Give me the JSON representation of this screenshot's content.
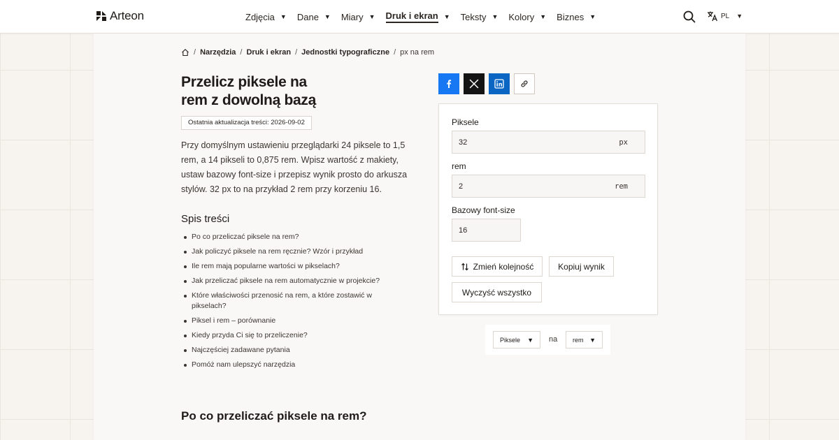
{
  "header": {
    "brand": "Arteon",
    "nav": [
      {
        "label": "Zdjęcia",
        "active": false
      },
      {
        "label": "Dane",
        "active": false
      },
      {
        "label": "Miary",
        "active": false
      },
      {
        "label": "Druk i ekran",
        "active": true
      },
      {
        "label": "Teksty",
        "active": false
      },
      {
        "label": "Kolory",
        "active": false
      },
      {
        "label": "Biznes",
        "active": false
      }
    ],
    "search_icon": "search-icon",
    "language": "PL",
    "language_icon": "translate-icon"
  },
  "breadcrumb": {
    "home_icon": "home-icon",
    "items": [
      "Narzędzia",
      "Druk i ekran",
      "Jednostki typograficzne"
    ],
    "current": "px na rem"
  },
  "article": {
    "title_line1": "Przelicz piksele na",
    "title_line2": "rem z dowolną bazą",
    "updated": "Ostatnia aktualizacja treści: 2026-09-02",
    "intro": "Przy domyślnym ustawieniu przeglądarki 24 piksele to 1,5 rem, a 14 pikseli to 0,875 rem. Wpisz wartość z makiety, ustaw bazowy font-size i przepisz wynik prosto do arkusza stylów. 32 px to na przykład 2 rem przy korzeniu 16.",
    "toc_title": "Spis treści",
    "toc": [
      "Po co przeliczać piksele na rem?",
      "Jak policzyć piksele na rem ręcznie? Wzór i przykład",
      "Ile rem mają popularne wartości w pikselach?",
      "Jak przeliczać piksele na rem automatycznie w projekcie?",
      "Które właściwości przenosić na rem, a które zostawić w pikselach?",
      "Piksel i rem – porównanie",
      "Kiedy przyda Ci się to przeliczenie?",
      "Najczęściej zadawane pytania",
      "Pomóż nam ulepszyć narzędzia"
    ],
    "section_heading": "Po co przeliczać piksele na rem?"
  },
  "share": {
    "facebook_icon": "facebook-icon",
    "x_icon": "x-icon",
    "linkedin_icon": "linkedin-icon",
    "link_icon": "link-icon"
  },
  "converter": {
    "pixels_label": "Piksele",
    "pixels_value": "32",
    "pixels_unit": "px",
    "rem_label": "rem",
    "rem_value": "2",
    "rem_unit": "rem",
    "base_label": "Bazowy font-size",
    "base_value": "16",
    "swap_label": "Zmień kolejność",
    "swap_icon": "swap-icon",
    "copy_label": "Kopiuj wynik",
    "clear_label": "Wyczyść wszystko"
  },
  "unit_select": {
    "from": "Piksele",
    "connector": "na",
    "to": "rem"
  },
  "colors": {
    "facebook": "#1877f2",
    "x": "#141414",
    "linkedin": "#0a66c2",
    "text": "#2b2622"
  }
}
